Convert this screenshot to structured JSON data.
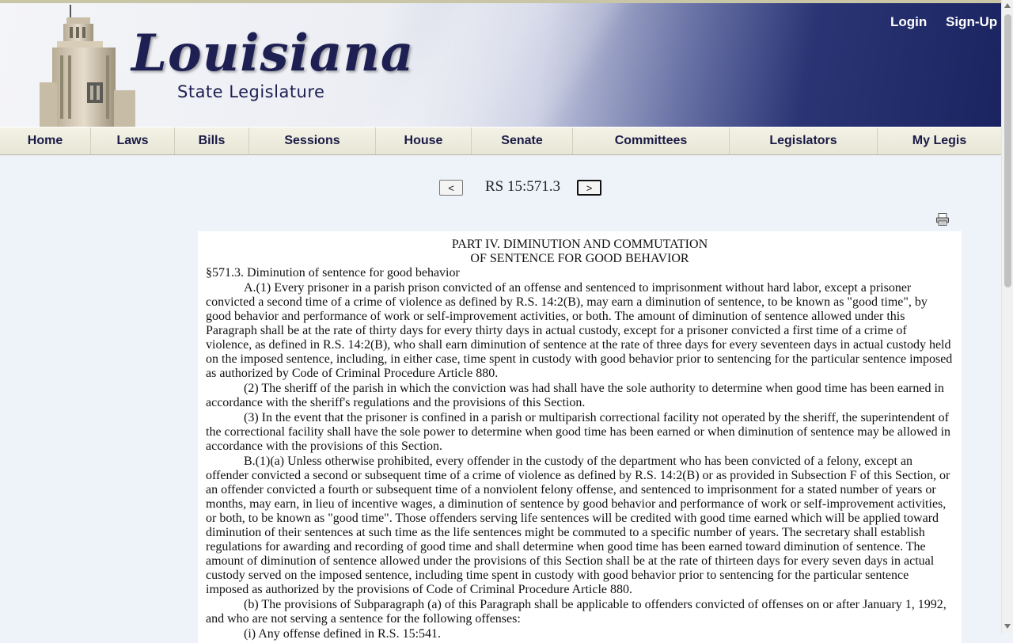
{
  "site": {
    "logo_script": "Louisiana",
    "logo_subtitle": "State Legislature",
    "login": "Login",
    "signup": "Sign-Up"
  },
  "nav": [
    {
      "label": "Home"
    },
    {
      "label": "Laws"
    },
    {
      "label": "Bills"
    },
    {
      "label": "Sessions"
    },
    {
      "label": "House"
    },
    {
      "label": "Senate"
    },
    {
      "label": "Committees"
    },
    {
      "label": "Legislators"
    },
    {
      "label": "My Legis"
    }
  ],
  "pager": {
    "prev": "<",
    "next": ">",
    "citation": "RS 15:571.3"
  },
  "icons": {
    "print": "printer-icon"
  },
  "document": {
    "part_line1": "PART IV. DIMINUTION AND COMMUTATION",
    "part_line2": "OF SENTENCE FOR GOOD BEHAVIOR",
    "section_title": "§571.3. Diminution of sentence for good behavior",
    "paragraphs": [
      "A.(1) Every prisoner in a parish prison convicted of an offense and sentenced to imprisonment without hard labor, except a prisoner convicted a second time of a crime of violence as defined by R.S. 14:2(B), may earn a diminution of sentence, to be known as \"good time\", by good behavior and performance of work or self-improvement activities, or both. The amount of diminution of sentence allowed under this Paragraph shall be at the rate of thirty days for every thirty days in actual custody, except for a prisoner convicted a first time of a crime of violence, as defined in R.S. 14:2(B), who shall earn diminution of sentence at the rate of three days for every seventeen days in actual custody held on the imposed sentence, including, in either case, time spent in custody with good behavior prior to sentencing for the particular sentence imposed as authorized by Code of Criminal Procedure Article 880.",
      "(2) The sheriff of the parish in which the conviction was had shall have the sole authority to determine when good time has been earned in accordance with the sheriff's regulations and the provisions of this Section.",
      "(3) In the event that the prisoner is confined in a parish or multiparish correctional facility not operated by the sheriff, the superintendent of the correctional facility shall have the sole power to determine when good time has been earned or when diminution of sentence may be allowed in accordance with the provisions of this Section.",
      "B.(1)(a) Unless otherwise prohibited, every offender in the custody of the department who has been convicted of a felony, except an offender convicted a second or subsequent time of a crime of violence as defined by R.S. 14:2(B) or as provided in Subsection F of this Section, or an offender convicted a fourth or subsequent time of a nonviolent felony offense, and sentenced to imprisonment for a stated number of years or months, may earn, in lieu of incentive wages, a diminution of sentence by good behavior and performance of work or self-improvement activities, or both, to be known as \"good time\". Those offenders serving life sentences will be credited with good time earned which will be applied toward diminution of their sentences at such time as the life sentences might be commuted to a specific number of years. The secretary shall establish regulations for awarding and recording of good time and shall determine when good time has been earned toward diminution of sentence. The amount of diminution of sentence allowed under the provisions of this Section shall be at the rate of thirteen days for every seven days in actual custody served on the imposed sentence, including time spent in custody with good behavior prior to sentencing for the particular sentence imposed as authorized by the provisions of Code of Criminal Procedure Article 880.",
      "(b) The provisions of Subparagraph (a) of this Paragraph shall be applicable to offenders convicted of offenses on or after January 1, 1992, and who are not serving a sentence for the following offenses:",
      "(i) Any offense defined in R.S. 15:541."
    ]
  }
}
